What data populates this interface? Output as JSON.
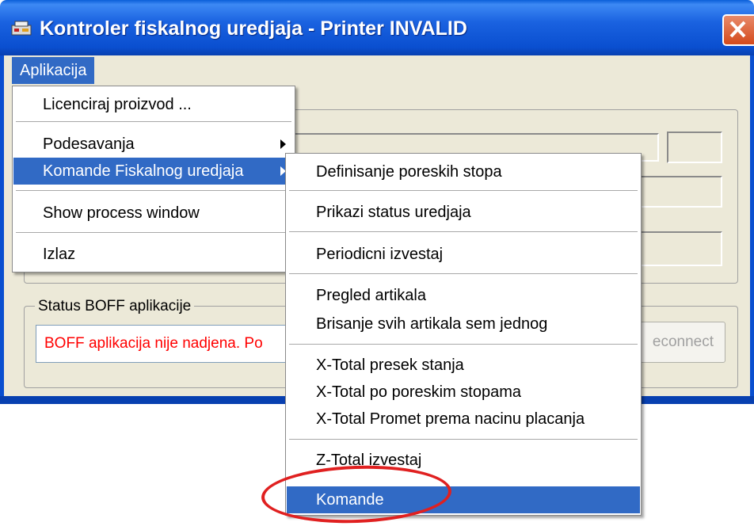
{
  "window": {
    "title": "Kontroler fiskalnog uredjaja - Printer INVALID"
  },
  "menubar": {
    "aplikacija": "Aplikacija"
  },
  "app_menu": {
    "items": [
      "Licenciraj proizvod ...",
      "Podesavanja",
      "Komande Fiskalnog uredjaja",
      "Show process window",
      "Izlaz"
    ]
  },
  "submenu": {
    "items": [
      "Definisanje poreskih stopa",
      "Prikazi status uredjaja",
      "Periodicni izvestaj",
      "Pregled artikala",
      "Brisanje svih artikala sem jednog",
      "X-Total presek stanja",
      "X-Total po poreskim stopama",
      "X-Total Promet prema nacinu placanja",
      "Z-Total izvestaj",
      "Komande"
    ]
  },
  "status_group": {
    "title": "Status BOFF aplikacije",
    "status_text": "BOFF aplikacija nije nadjena. Po",
    "reconnect_label": "econnect"
  },
  "colors": {
    "titlebar": "#0a4fd0",
    "selection": "#316ac5",
    "error_text": "#ff0000",
    "annotation": "#e02020"
  }
}
